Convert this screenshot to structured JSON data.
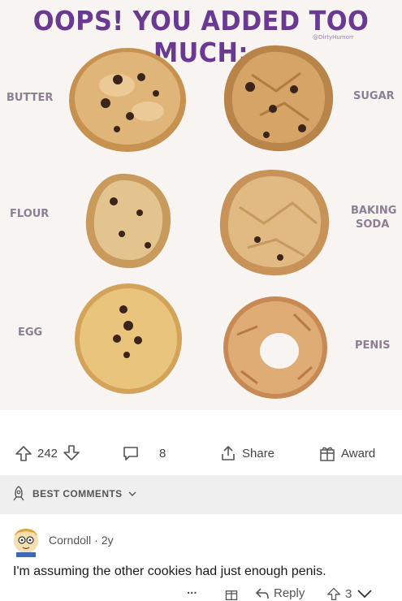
{
  "post": {
    "title": "OOPS! YOU ADDED TOO MUCH:",
    "credit": "@DirtyHumorr",
    "labels": {
      "butter": "BUTTER",
      "sugar": "SUGAR",
      "flour": "FLOUR",
      "baking_soda_line1": "BAKING",
      "baking_soda_line2": "SODA",
      "egg": "EGG",
      "penis": "PENIS"
    }
  },
  "actions": {
    "upvotes": "242",
    "comments": "8",
    "share_label": "Share",
    "award_label": "Award"
  },
  "sort": {
    "label": "BEST COMMENTS"
  },
  "comment": {
    "author": "Corndoll",
    "age": "2y",
    "text": "I'm assuming the other cookies had just enough penis.",
    "more": "...",
    "reply_label": "Reply",
    "votes": "3"
  },
  "colors": {
    "title": "#6a3a93",
    "label": "#8d7f93",
    "cookie": "#d9a86a",
    "chip": "#4a2e22"
  }
}
